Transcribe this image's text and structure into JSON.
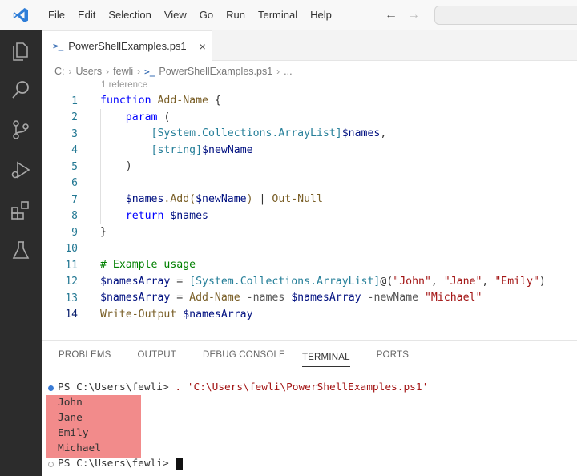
{
  "menu": [
    "File",
    "Edit",
    "Selection",
    "View",
    "Go",
    "Run",
    "Terminal",
    "Help"
  ],
  "activity_icons": [
    "explorer-icon",
    "search-icon",
    "source-control-icon",
    "run-debug-icon",
    "extensions-icon",
    "testing-icon"
  ],
  "tab": {
    "label": "PowerShellExamples.ps1",
    "close": "×",
    "icon": "powershell-file-icon"
  },
  "breadcrumb": {
    "drive": "C:",
    "users": "Users",
    "user": "fewli",
    "file": "PowerShellExamples.ps1",
    "more": "..."
  },
  "codelens": "1 reference",
  "line_numbers": [
    "1",
    "2",
    "3",
    "4",
    "5",
    "6",
    "7",
    "8",
    "9",
    "10",
    "11",
    "12",
    "13",
    "14"
  ],
  "code": {
    "l1_kw": "function",
    "l1_name": "Add-Name",
    "l1_brace": " {",
    "l2_kw": "param",
    "l2_paren": " (",
    "l3_type": "[System.Collections.ArrayList]",
    "l3_var": "$names",
    "l3_comma": ",",
    "l4_type": "[string]",
    "l4_var": "$newName",
    "l5": ")",
    "l7_var": "$names",
    "l7_method": ".Add(",
    "l7_arg": "$newName",
    "l7_close": ")",
    "l7_pipe": " | ",
    "l7_cmd": "Out-Null",
    "l8_kw": "return",
    "l8_var": " $names",
    "l9": "}",
    "l11": "# Example usage",
    "l12_var": "$namesArray",
    "l12_eq": " = ",
    "l12_type": "[System.Collections.ArrayList]",
    "l12_at": "@(",
    "l12_s1": "\"John\"",
    "l12_c1": ", ",
    "l12_s2": "\"Jane\"",
    "l12_c2": ", ",
    "l12_s3": "\"Emily\"",
    "l12_close": ")",
    "l13_var": "$namesArray",
    "l13_eq": " = ",
    "l13_cmd": "Add-Name",
    "l13_p1": " -names ",
    "l13_v1": "$namesArray",
    "l13_p2": " -newName ",
    "l13_s": "\"Michael\"",
    "l14_cmd": "Write-Output",
    "l14_var": " $namesArray"
  },
  "panel_tabs": [
    "PROBLEMS",
    "OUTPUT",
    "DEBUG CONSOLE",
    "TERMINAL",
    "PORTS"
  ],
  "active_panel_tab": "TERMINAL",
  "terminal": {
    "prompt1": "PS C:\\Users\\fewli> ",
    "command1": ". 'C:\\Users\\fewli\\PowerShellExamples.ps1'",
    "output": [
      "John",
      "Jane",
      "Emily",
      "Michael"
    ],
    "prompt2": "PS C:\\Users\\fewli> "
  },
  "colors": {
    "highlight": "#f28b8b",
    "activity_bar": "#2c2c2c",
    "success_dot": "#3a7bd5",
    "idle_dot": "#aaaaaa"
  }
}
